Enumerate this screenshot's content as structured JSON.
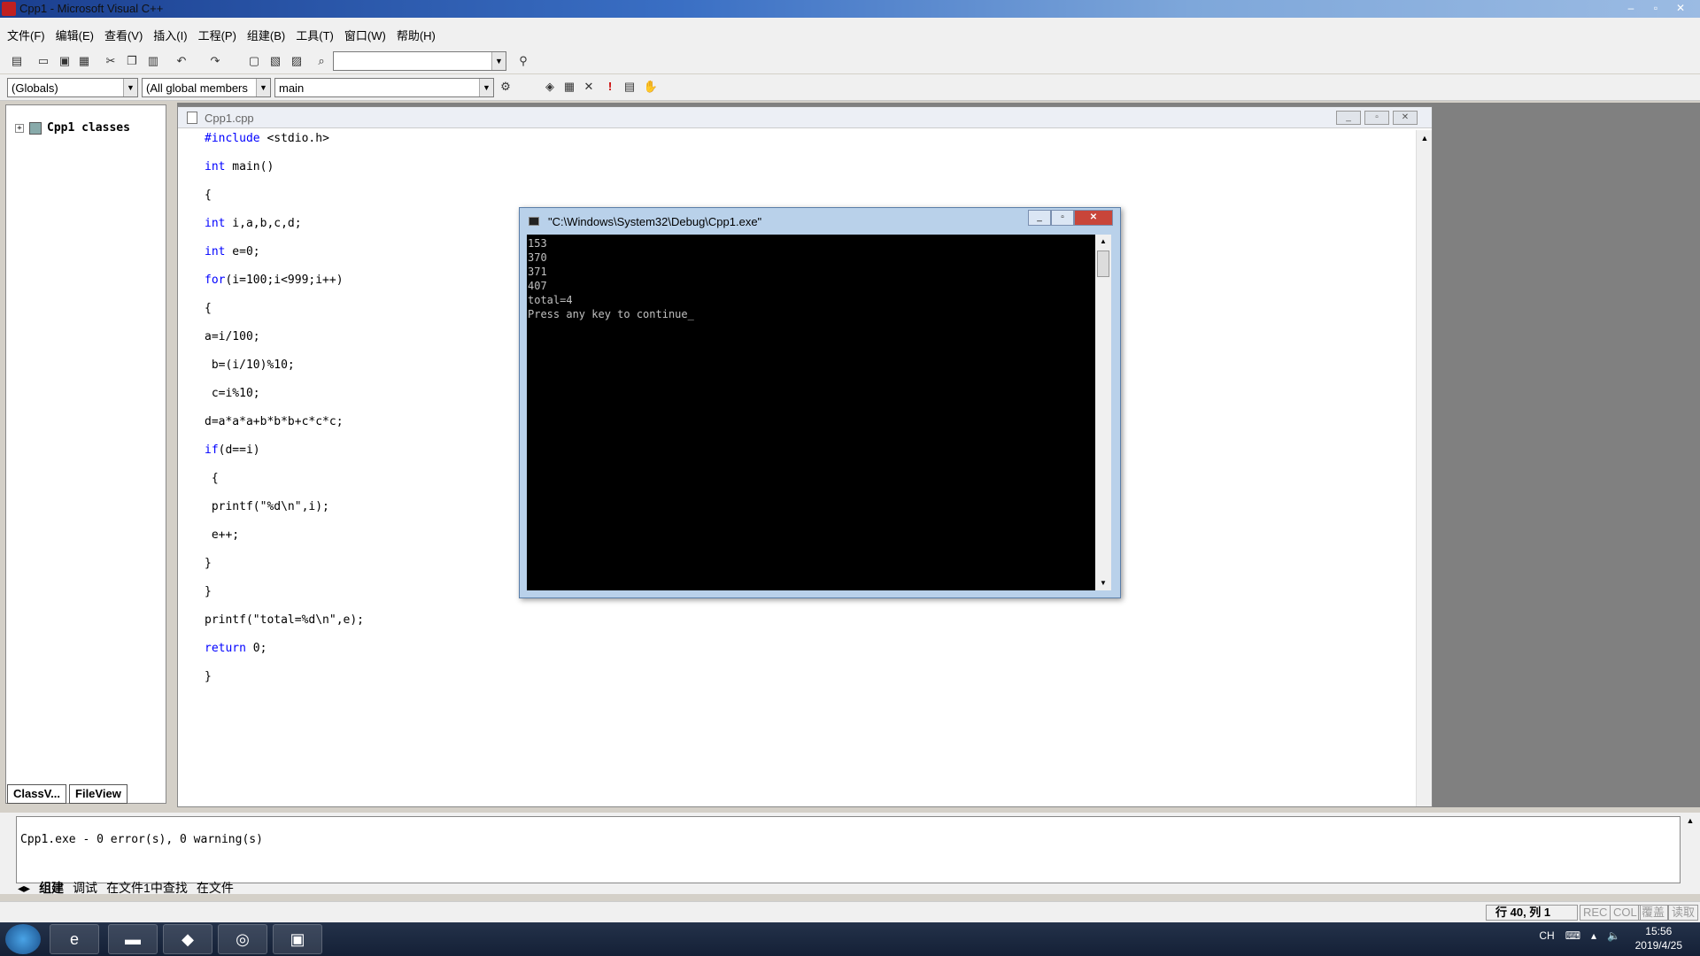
{
  "window": {
    "title": "Cpp1 - Microsoft Visual C++",
    "min": "–",
    "max": "▫",
    "close": "✕"
  },
  "menu": [
    "文件(F)",
    "编辑(E)",
    "查看(V)",
    "插入(I)",
    "工程(P)",
    "组建(B)",
    "工具(T)",
    "窗口(W)",
    "帮助(H)"
  ],
  "toolbar": {
    "globals": "(Globals)",
    "members": "(All global members",
    "function": "main",
    "search": ""
  },
  "workspace": {
    "tree_root": "Cpp1 classes",
    "tabs": [
      "ClassV...",
      "FileView"
    ]
  },
  "editor": {
    "filename": "Cpp1.cpp",
    "lines": [
      {
        "kw": "#include",
        "rest": " <stdio.h>"
      },
      {
        "kw": "int",
        "rest": " main()"
      },
      {
        "kw": "",
        "rest": "{"
      },
      {
        "kw": "int",
        "rest": " i,a,b,c,d;"
      },
      {
        "kw": "int",
        "rest": " e=0;"
      },
      {
        "kw": "for",
        "rest": "(i=100;i<999;i++)"
      },
      {
        "kw": "",
        "rest": "{"
      },
      {
        "kw": "",
        "rest": "a=i/100;"
      },
      {
        "kw": "",
        "rest": " b=(i/10)%10;"
      },
      {
        "kw": "",
        "rest": " c=i%10;"
      },
      {
        "kw": "",
        "rest": "d=a*a*a+b*b*b+c*c*c;"
      },
      {
        "kw": "if",
        "rest": "(d==i)"
      },
      {
        "kw": "",
        "rest": " {"
      },
      {
        "kw": "",
        "rest": " printf(\"%d\\n\",i);"
      },
      {
        "kw": "",
        "rest": " e++;"
      },
      {
        "kw": "",
        "rest": "}"
      },
      {
        "kw": "",
        "rest": "}"
      },
      {
        "kw": "",
        "rest": "printf(\"total=%d\\n\",e);"
      },
      {
        "kw": "return",
        "rest": " 0;"
      },
      {
        "kw": "",
        "rest": "}"
      }
    ]
  },
  "console": {
    "title": "\"C:\\Windows\\System32\\Debug\\Cpp1.exe\"",
    "lines": [
      "153",
      "370",
      "371",
      "407",
      "total=4",
      "Press any key to continue_"
    ]
  },
  "output": {
    "message": "Cpp1.exe - 0 error(s), 0 warning(s)",
    "tabs": [
      "组建",
      "调试",
      "在文件1中查找",
      "在文件"
    ]
  },
  "status": {
    "position": "行 40, 列 1",
    "indicators": [
      "REC",
      "COL",
      "覆盖",
      "读取"
    ]
  },
  "taskbar": {
    "lang": "CH",
    "time": "15:56",
    "date": "2019/4/25"
  },
  "colors": {
    "keyword": "#0000ff",
    "console_bg": "#000000",
    "console_fg": "#c0c0c0"
  }
}
